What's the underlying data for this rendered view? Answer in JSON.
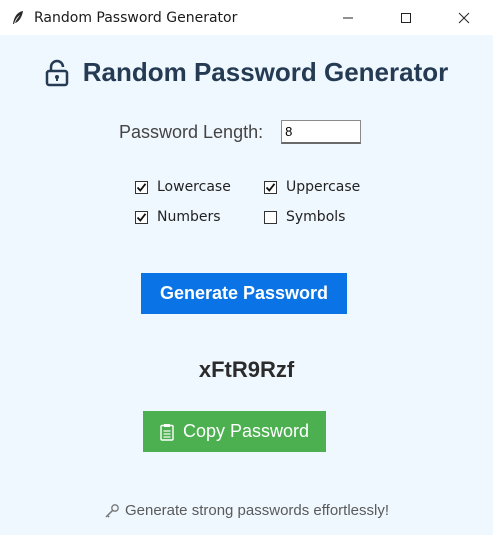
{
  "window": {
    "title": "Random Password Generator",
    "icon": "feather-icon"
  },
  "heading": {
    "text": "Random Password Generator",
    "icon": "lock-icon"
  },
  "length": {
    "label": "Password Length:",
    "value": "8"
  },
  "options": [
    {
      "label": "Lowercase",
      "checked": true
    },
    {
      "label": "Uppercase",
      "checked": true
    },
    {
      "label": "Numbers",
      "checked": true
    },
    {
      "label": "Symbols",
      "checked": false
    }
  ],
  "generate_button": {
    "label": "Generate Password",
    "color": "#0a74e6"
  },
  "password": {
    "value": "xFtR9Rzf"
  },
  "copy_button": {
    "label": "Copy Password",
    "icon": "clipboard-icon",
    "color": "#4caf50"
  },
  "footer": {
    "text": "Generate strong passwords effortlessly!",
    "icon": "key-icon"
  },
  "colors": {
    "background": "#f0f8ff",
    "heading": "#253b54"
  }
}
